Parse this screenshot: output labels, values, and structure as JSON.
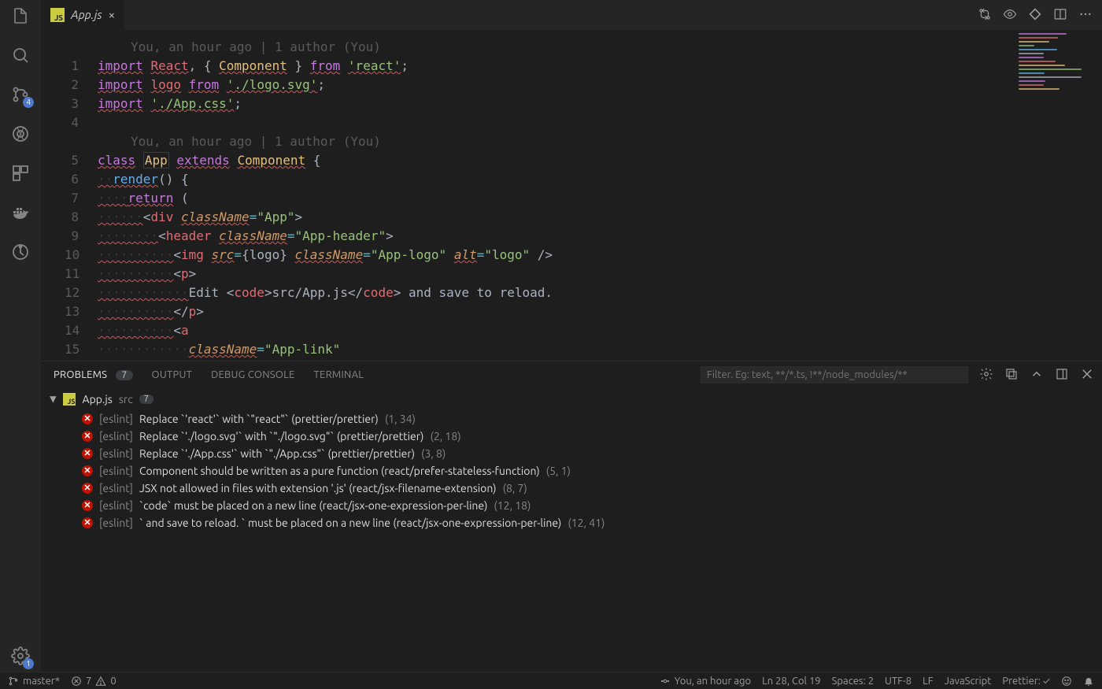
{
  "tab": {
    "filename": "App.js",
    "close_label": "×"
  },
  "activity": {
    "scm_badge": "4",
    "settings_badge": "1"
  },
  "editor": {
    "blame_line": "You, an hour ago | 1 author (You)",
    "font": "monospace"
  },
  "code": {
    "l1": {
      "ln": "1",
      "seg": [
        {
          "t": "import",
          "c": "kw",
          "u": 1
        },
        {
          "t": " ",
          "c": "punc"
        },
        {
          "t": "React",
          "c": "def",
          "u": 1
        },
        {
          "t": ", { ",
          "c": "punc"
        },
        {
          "t": "Component",
          "c": "cls",
          "u": 1
        },
        {
          "t": " } ",
          "c": "punc"
        },
        {
          "t": "from",
          "c": "kw",
          "u": 1
        },
        {
          "t": " ",
          "c": "punc"
        },
        {
          "t": "'react'",
          "c": "str",
          "u": 1
        },
        {
          "t": ";",
          "c": "punc"
        }
      ]
    },
    "l2": {
      "ln": "2",
      "seg": [
        {
          "t": "import",
          "c": "kw",
          "u": 1
        },
        {
          "t": " ",
          "c": "punc"
        },
        {
          "t": "logo",
          "c": "def",
          "u": 1
        },
        {
          "t": " ",
          "c": "punc"
        },
        {
          "t": "from",
          "c": "kw",
          "u": 1
        },
        {
          "t": " ",
          "c": "punc"
        },
        {
          "t": "'./logo.svg'",
          "c": "str",
          "u": 1
        },
        {
          "t": ";",
          "c": "punc"
        }
      ]
    },
    "l3": {
      "ln": "3",
      "seg": [
        {
          "t": "import",
          "c": "kw",
          "u": 1
        },
        {
          "t": " ",
          "c": "punc"
        },
        {
          "t": "'./App.css'",
          "c": "str",
          "u": 1
        },
        {
          "t": ";",
          "c": "punc"
        }
      ]
    },
    "l4": {
      "ln": "4",
      "seg": [
        {
          "t": "",
          "c": "punc"
        }
      ]
    },
    "l5": {
      "ln": "5",
      "seg": [
        {
          "t": "class",
          "c": "kw",
          "u": 1
        },
        {
          "t": " ",
          "c": "punc"
        },
        {
          "t": "App",
          "c": "cls",
          "box": 1
        },
        {
          "t": " ",
          "c": "punc"
        },
        {
          "t": "extends",
          "c": "kw",
          "u": 1
        },
        {
          "t": " ",
          "c": "punc"
        },
        {
          "t": "Component",
          "c": "cls",
          "u": 1
        },
        {
          "t": " {",
          "c": "punc"
        }
      ]
    },
    "l6": {
      "ln": "6",
      "seg": [
        {
          "t": "··",
          "c": "ws",
          "u": 1
        },
        {
          "t": "render",
          "c": "fn",
          "u": 1
        },
        {
          "t": "() {",
          "c": "punc"
        }
      ]
    },
    "l7": {
      "ln": "7",
      "seg": [
        {
          "t": "····",
          "c": "ws",
          "u": 1
        },
        {
          "t": "return",
          "c": "kw",
          "u": 1
        },
        {
          "t": " (",
          "c": "punc"
        }
      ]
    },
    "l8": {
      "ln": "8",
      "seg": [
        {
          "t": "······",
          "c": "ws",
          "u": 1
        },
        {
          "t": "<",
          "c": "punc"
        },
        {
          "t": "div",
          "c": "tag"
        },
        {
          "t": " ",
          "c": "punc"
        },
        {
          "t": "className",
          "c": "attr",
          "u": 1
        },
        {
          "t": "=",
          "c": "op"
        },
        {
          "t": "\"App\"",
          "c": "str"
        },
        {
          "t": ">",
          "c": "punc"
        }
      ]
    },
    "l9": {
      "ln": "9",
      "seg": [
        {
          "t": "········",
          "c": "ws",
          "u": 1
        },
        {
          "t": "<",
          "c": "punc"
        },
        {
          "t": "header",
          "c": "tag"
        },
        {
          "t": " ",
          "c": "punc"
        },
        {
          "t": "className",
          "c": "attr",
          "u": 1
        },
        {
          "t": "=",
          "c": "op"
        },
        {
          "t": "\"App-header\"",
          "c": "str"
        },
        {
          "t": ">",
          "c": "punc"
        }
      ]
    },
    "l10": {
      "ln": "10",
      "seg": [
        {
          "t": "··········",
          "c": "ws",
          "u": 1
        },
        {
          "t": "<",
          "c": "punc"
        },
        {
          "t": "img",
          "c": "tag"
        },
        {
          "t": " ",
          "c": "punc"
        },
        {
          "t": "src",
          "c": "attr",
          "u": 1
        },
        {
          "t": "=",
          "c": "op"
        },
        {
          "t": "{logo}",
          "c": "txt"
        },
        {
          "t": " ",
          "c": "punc"
        },
        {
          "t": "className",
          "c": "attr",
          "u": 1
        },
        {
          "t": "=",
          "c": "op"
        },
        {
          "t": "\"App-logo\"",
          "c": "str"
        },
        {
          "t": " ",
          "c": "punc"
        },
        {
          "t": "alt",
          "c": "attr",
          "u": 1
        },
        {
          "t": "=",
          "c": "op"
        },
        {
          "t": "\"logo\"",
          "c": "str"
        },
        {
          "t": " />",
          "c": "punc"
        }
      ]
    },
    "l11": {
      "ln": "11",
      "seg": [
        {
          "t": "··········",
          "c": "ws",
          "u": 1
        },
        {
          "t": "<",
          "c": "punc"
        },
        {
          "t": "p",
          "c": "tag"
        },
        {
          "t": ">",
          "c": "punc"
        }
      ]
    },
    "l12": {
      "ln": "12",
      "seg": [
        {
          "t": "············",
          "c": "ws",
          "u": 1
        },
        {
          "t": "Edit ",
          "c": "txt"
        },
        {
          "t": "<",
          "c": "punc"
        },
        {
          "t": "code",
          "c": "tag"
        },
        {
          "t": ">",
          "c": "punc"
        },
        {
          "t": "src/App.js",
          "c": "txt"
        },
        {
          "t": "</",
          "c": "punc"
        },
        {
          "t": "code",
          "c": "tag"
        },
        {
          "t": ">",
          "c": "punc"
        },
        {
          "t": " and save to reload.",
          "c": "txt"
        }
      ]
    },
    "l13": {
      "ln": "13",
      "seg": [
        {
          "t": "··········",
          "c": "ws",
          "u": 1
        },
        {
          "t": "</",
          "c": "punc"
        },
        {
          "t": "p",
          "c": "tag"
        },
        {
          "t": ">",
          "c": "punc"
        }
      ]
    },
    "l14": {
      "ln": "14",
      "seg": [
        {
          "t": "··········",
          "c": "ws",
          "u": 1
        },
        {
          "t": "<",
          "c": "punc"
        },
        {
          "t": "a",
          "c": "tag"
        }
      ]
    },
    "l15": {
      "ln": "15",
      "seg": [
        {
          "t": "············",
          "c": "ws"
        },
        {
          "t": "className",
          "c": "attr",
          "u": 1
        },
        {
          "t": "=",
          "c": "op"
        },
        {
          "t": "\"App-link\"",
          "c": "str"
        }
      ]
    }
  },
  "panel": {
    "tabs": {
      "problems": "PROBLEMS",
      "problems_count": "7",
      "output": "OUTPUT",
      "debug": "DEBUG CONSOLE",
      "terminal": "TERMINAL"
    },
    "filter_placeholder": "Filter. Eg: text, **/*.ts, !**/node_modules/**",
    "file": {
      "name": "App.js",
      "dir": "src",
      "count": "7"
    },
    "items": [
      {
        "src": "[eslint]",
        "msg": "Replace `'react'` with `\"react\"` (prettier/prettier)",
        "loc": "(1, 34)"
      },
      {
        "src": "[eslint]",
        "msg": "Replace `'./logo.svg'` with `\"./logo.svg\"` (prettier/prettier)",
        "loc": "(2, 18)"
      },
      {
        "src": "[eslint]",
        "msg": "Replace `'./App.css'` with `\"./App.css\"` (prettier/prettier)",
        "loc": "(3, 8)"
      },
      {
        "src": "[eslint]",
        "msg": "Component should be written as a pure function (react/prefer-stateless-function)",
        "loc": "(5, 1)"
      },
      {
        "src": "[eslint]",
        "msg": "JSX not allowed in files with extension '.js' (react/jsx-filename-extension)",
        "loc": "(8, 7)"
      },
      {
        "src": "[eslint]",
        "msg": "`code` must be placed on a new line (react/jsx-one-expression-per-line)",
        "loc": "(12, 18)"
      },
      {
        "src": "[eslint]",
        "msg": "` and save to reload. ` must be placed on a new line (react/jsx-one-expression-per-line)",
        "loc": "(12, 41)"
      }
    ]
  },
  "status": {
    "branch": "master*",
    "errors": "7",
    "warnings": "0",
    "blame": "You, an hour ago",
    "position": "Ln 28, Col 19",
    "spaces": "Spaces: 2",
    "encoding": "UTF-8",
    "eol": "LF",
    "language": "JavaScript",
    "prettier": "Prettier: ✓"
  }
}
